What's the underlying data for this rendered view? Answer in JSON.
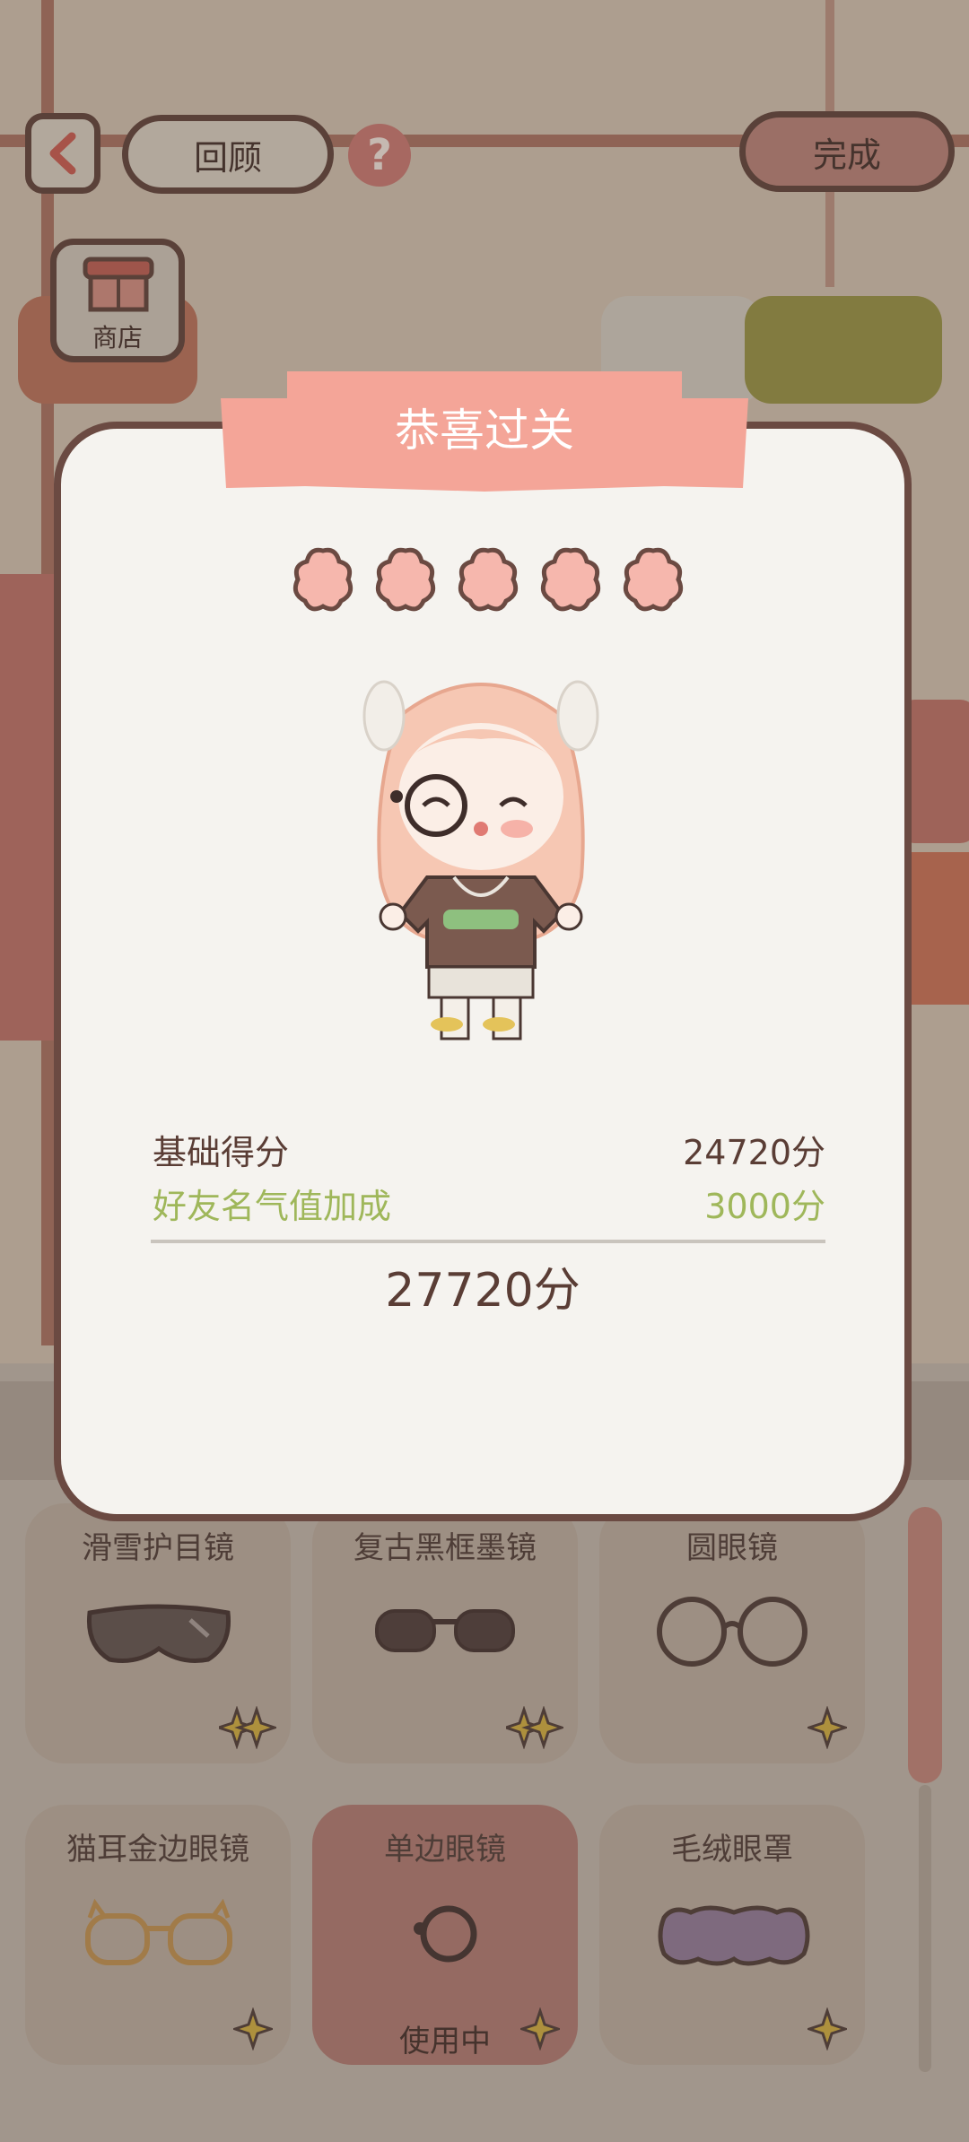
{
  "topbar": {
    "back_icon": "chevron-left-icon",
    "review_label": "回顾",
    "help_icon": "question-mark-icon",
    "done_label": "完成"
  },
  "shop": {
    "label": "商店",
    "icon": "shop-stall-icon"
  },
  "dialog": {
    "title": "恭喜过关",
    "stars": 5,
    "base_score_label": "基础得分",
    "base_score_value": "24720分",
    "bonus_label": "好友名气值加成",
    "bonus_value": "3000分",
    "total": "27720分",
    "colors": {
      "ribbon": "#f4a598",
      "bonus_text": "#9fb75a",
      "text": "#5a3d35",
      "star": "#f6b7ad"
    }
  },
  "items": [
    {
      "label": "滑雪护目镜",
      "icon": "ski-goggles-icon",
      "rarity": 2
    },
    {
      "label": "复古黑框墨镜",
      "icon": "black-sunglasses-icon",
      "rarity": 2
    },
    {
      "label": "圆眼镜",
      "icon": "round-glasses-icon",
      "rarity": 1
    },
    {
      "label": "猫耳金边眼镜",
      "icon": "cat-ear-glasses-icon",
      "rarity": 1
    },
    {
      "label": "单边眼镜",
      "icon": "monocle-icon",
      "rarity": 1,
      "status": "使用中",
      "selected": true
    },
    {
      "label": "毛绒眼罩",
      "icon": "plush-eye-mask-icon",
      "rarity": 1
    }
  ]
}
